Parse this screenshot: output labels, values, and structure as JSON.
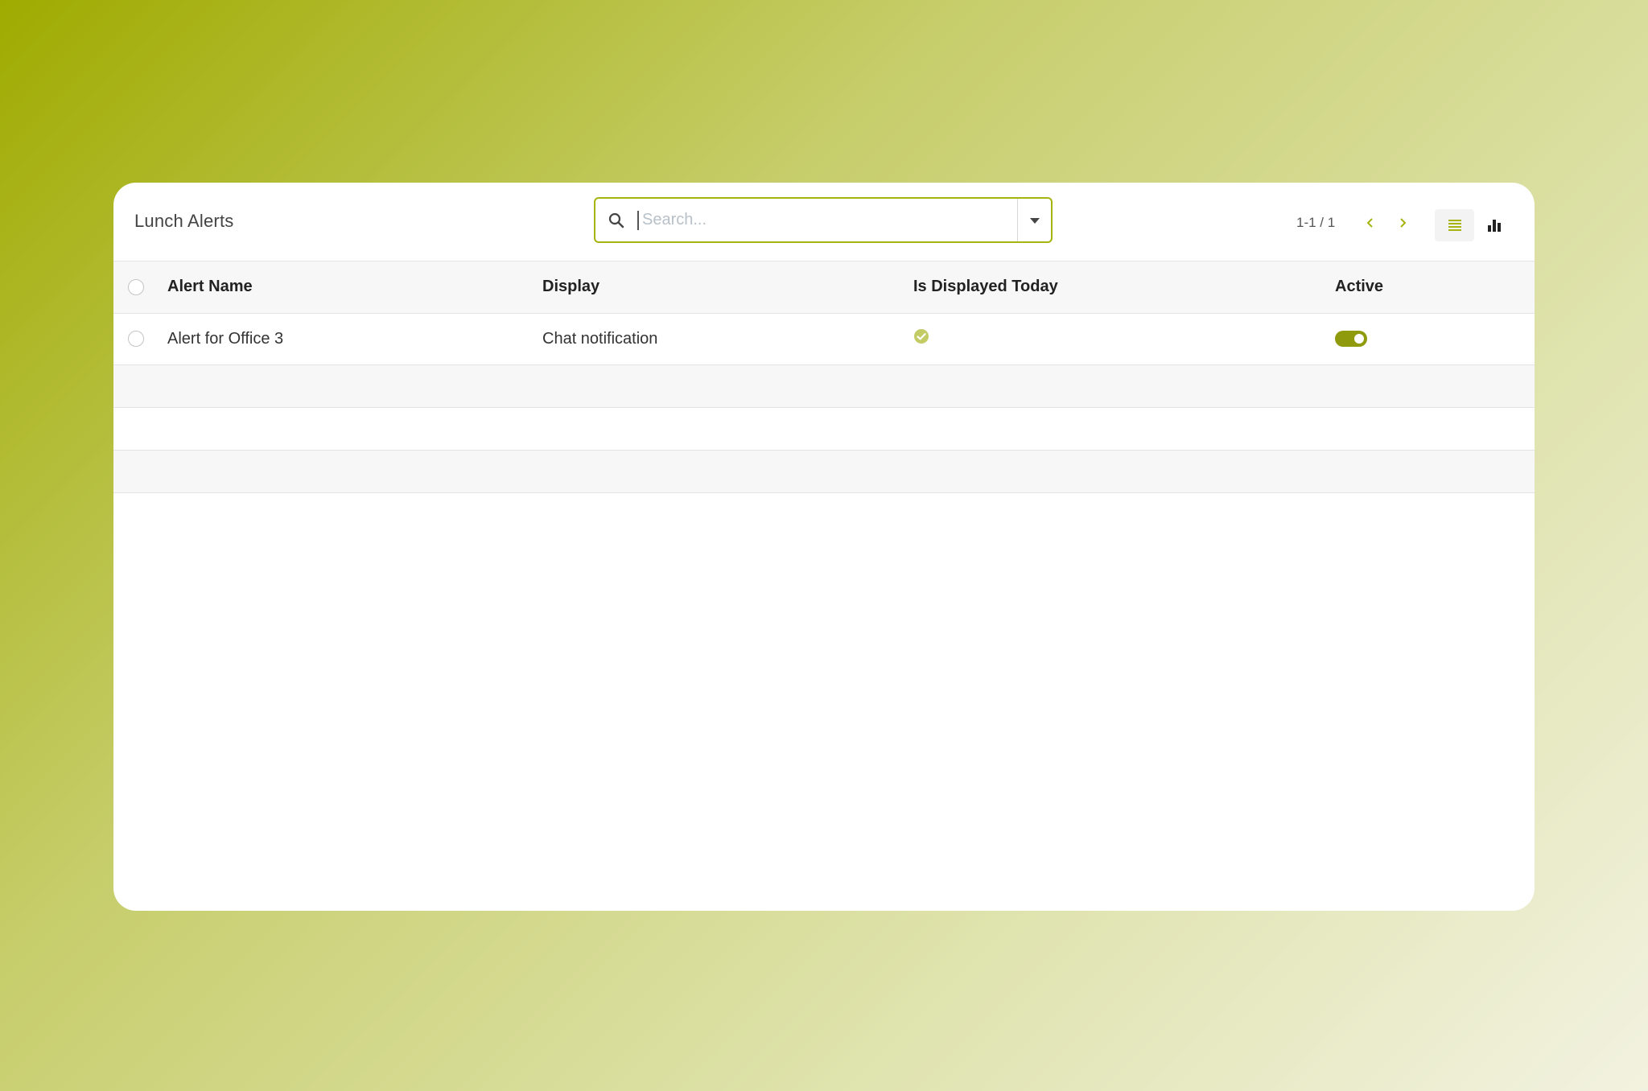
{
  "page": {
    "title": "Lunch Alerts"
  },
  "search": {
    "placeholder": "Search...",
    "value": ""
  },
  "pager": {
    "value": "1-1 / 1"
  },
  "colors": {
    "accent": "#a6b40f",
    "toggle_on": "#8f9b0d",
    "check_badge": "#c3cb64"
  },
  "table": {
    "columns": [
      "Alert Name",
      "Display",
      "Is Displayed Today",
      "Active"
    ],
    "rows": [
      {
        "alert_name": "Alert for Office 3",
        "display": "Chat notification",
        "is_displayed_today": true,
        "active": true
      }
    ]
  },
  "icons": {
    "search": "search-icon",
    "dropdown": "caret-down-icon",
    "prev": "chevron-left-icon",
    "next": "chevron-right-icon",
    "list_view": "list-view-icon",
    "graph_view": "bar-chart-icon",
    "check": "check-circle-icon"
  }
}
